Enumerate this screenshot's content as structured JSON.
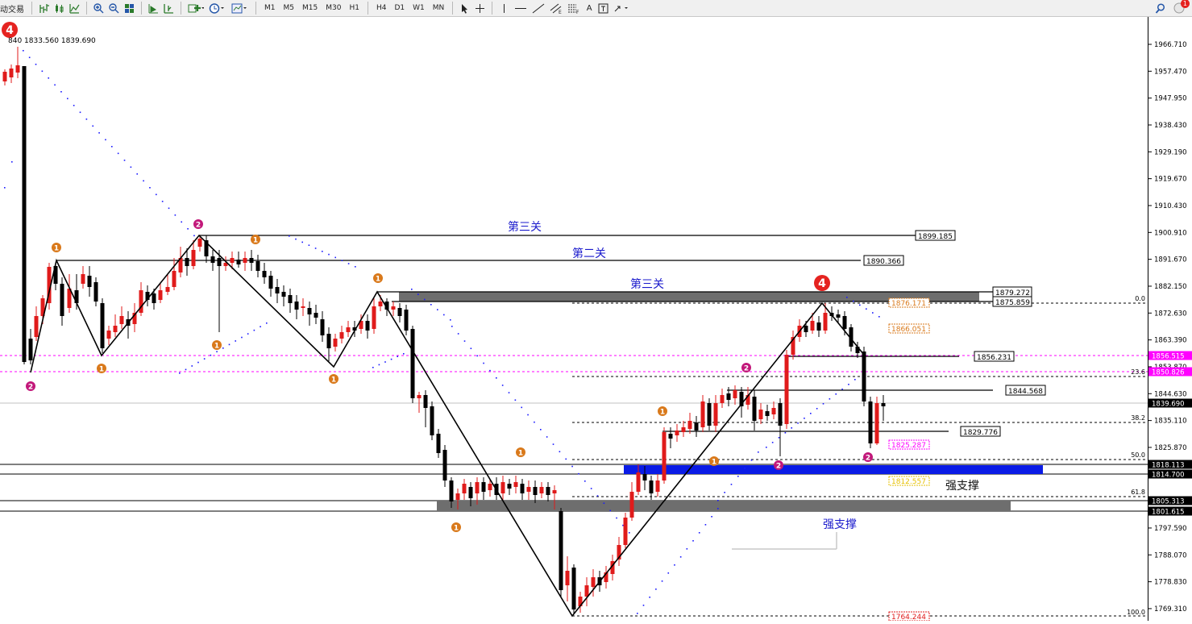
{
  "toolbar": {
    "app_label": "动交易",
    "timeframes": [
      "M1",
      "M5",
      "M15",
      "M30",
      "H1",
      "H4",
      "D1",
      "W1",
      "MN"
    ],
    "text_tool": "A",
    "notification_count": "1"
  },
  "ohlc_label": "840 1833.560 1839.690",
  "wave_marker": "4",
  "level_labels": {
    "third_gate_1": "第三关",
    "second_gate": "第二关",
    "third_gate_2": "第三关",
    "strong_support_1": "强支撑",
    "strong_support_2": "强支撑"
  },
  "price_boxes": [
    "1899.185",
    "1890.366",
    "1879.272",
    "1875.859",
    "1856.231",
    "1844.568",
    "1829.776"
  ],
  "fib_labels": [
    "1876.171",
    "1866.051",
    "1825.287",
    "1812.557",
    "1764.244"
  ],
  "fib_levels": [
    "0.0",
    "23.6",
    "38.2",
    "50.0",
    "61.8",
    "100.0"
  ],
  "price_axis": {
    "ticks": [
      "1966.710",
      "1957.470",
      "1947.950",
      "1938.430",
      "1929.190",
      "1919.670",
      "1910.430",
      "1900.910",
      "1891.670",
      "1882.150",
      "1872.630",
      "1863.390",
      "1853.870",
      "1844.630",
      "1835.110",
      "1825.870",
      "1816.350",
      "1807.110",
      "1797.590",
      "1788.070",
      "1778.830",
      "1769.310"
    ],
    "tags": [
      {
        "value": "1856.515",
        "color": "#ff00ff"
      },
      {
        "value": "1850.826",
        "color": "#ff00ff"
      },
      {
        "value": "1839.690",
        "color": "#000000"
      },
      {
        "value": "1818.113",
        "color": "#000000"
      },
      {
        "value": "1814.700",
        "color": "#000000"
      },
      {
        "value": "1805.313",
        "color": "#000000"
      },
      {
        "value": "1801.615",
        "color": "#000000"
      }
    ]
  },
  "colors": {
    "bull": "#e01b1b",
    "bear": "#000000",
    "dots": "#1a1aff",
    "magenta": "#ff00ff",
    "blue_zone": "#0a1be6",
    "gray_zone": "#6e6e6e",
    "orange_marker": "#d9791b",
    "purple_marker": "#c2187a",
    "gate_text": "#1a1acc"
  }
}
